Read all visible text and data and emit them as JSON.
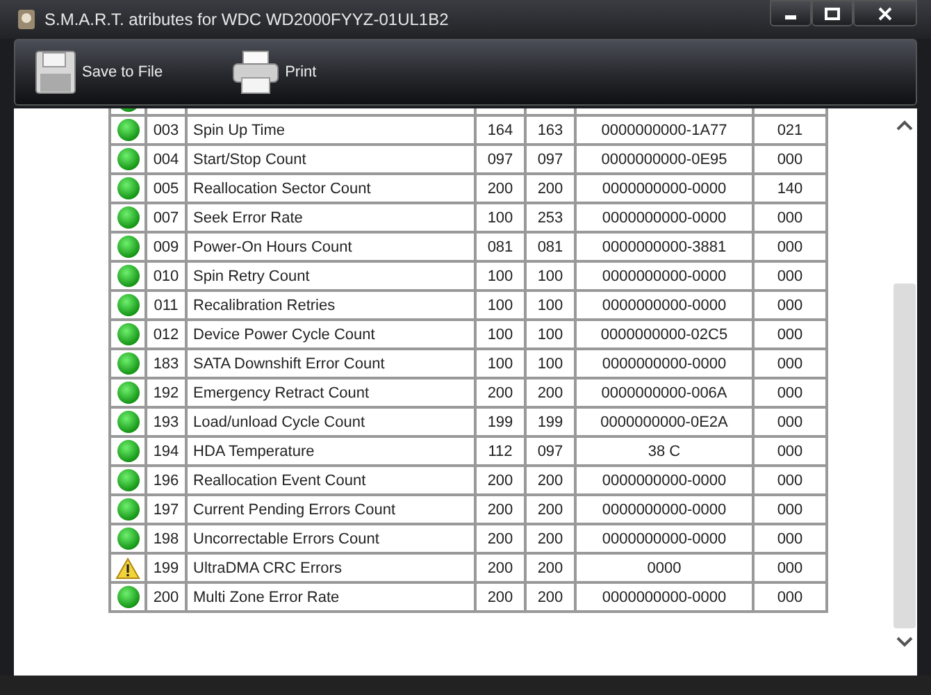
{
  "window": {
    "title": "S.M.A.R.T. atributes for WDC WD2000FYYZ-01UL1B2"
  },
  "toolbar": [
    {
      "kind": "save",
      "label": "Save to File"
    },
    {
      "kind": "print",
      "label": "Print"
    }
  ],
  "rows": [
    {
      "warning": false
    },
    {
      "warning": false,
      "id": "003",
      "name": "Spin Up Time",
      "value": "164",
      "worst": "163",
      "raw": "0000000000-1A77",
      "threshold": "021"
    },
    {
      "warning": false,
      "id": "004",
      "name": "Start/Stop Count",
      "value": "097",
      "worst": "097",
      "raw": "0000000000-0E95",
      "threshold": "000"
    },
    {
      "warning": false,
      "id": "005",
      "name": "Reallocation Sector Count",
      "value": "200",
      "worst": "200",
      "raw": "0000000000-0000",
      "threshold": "140"
    },
    {
      "warning": false,
      "id": "007",
      "name": "Seek Error Rate",
      "value": "100",
      "worst": "253",
      "raw": "0000000000-0000",
      "threshold": "000"
    },
    {
      "warning": false,
      "id": "009",
      "name": "Power-On Hours Count",
      "value": "081",
      "worst": "081",
      "raw": "0000000000-3881",
      "threshold": "000"
    },
    {
      "warning": false,
      "id": "010",
      "name": "Spin Retry Count",
      "value": "100",
      "worst": "100",
      "raw": "0000000000-0000",
      "threshold": "000"
    },
    {
      "warning": false,
      "id": "011",
      "name": "Recalibration Retries",
      "value": "100",
      "worst": "100",
      "raw": "0000000000-0000",
      "threshold": "000"
    },
    {
      "warning": false,
      "id": "012",
      "name": "Device Power Cycle Count",
      "value": "100",
      "worst": "100",
      "raw": "0000000000-02C5",
      "threshold": "000"
    },
    {
      "warning": false,
      "id": "183",
      "name": "SATA Downshift Error Count",
      "value": "100",
      "worst": "100",
      "raw": "0000000000-0000",
      "threshold": "000"
    },
    {
      "warning": false,
      "id": "192",
      "name": "Emergency Retract Count",
      "value": "200",
      "worst": "200",
      "raw": "0000000000-006A",
      "threshold": "000"
    },
    {
      "warning": false,
      "id": "193",
      "name": "Load/unload Cycle Count",
      "value": "199",
      "worst": "199",
      "raw": "0000000000-0E2A",
      "threshold": "000"
    },
    {
      "warning": false,
      "id": "194",
      "name": "HDA Temperature",
      "value": "112",
      "worst": "097",
      "raw": "38 C",
      "threshold": "000"
    },
    {
      "warning": false,
      "id": "196",
      "name": "Reallocation Event Count",
      "value": "200",
      "worst": "200",
      "raw": "0000000000-0000",
      "threshold": "000"
    },
    {
      "warning": false,
      "id": "197",
      "name": "Current Pending Errors Count",
      "value": "200",
      "worst": "200",
      "raw": "0000000000-0000",
      "threshold": "000"
    },
    {
      "warning": false,
      "id": "198",
      "name": "Uncorrectable Errors Count",
      "value": "200",
      "worst": "200",
      "raw": "0000000000-0000",
      "threshold": "000"
    },
    {
      "warning": true,
      "id": "199",
      "name": "UltraDMA CRC Errors",
      "value": "200",
      "worst": "200",
      "raw": "0000",
      "threshold": "000"
    },
    {
      "warning": false,
      "id": "200",
      "name": "Multi Zone Error Rate",
      "value": "200",
      "worst": "200",
      "raw": "0000000000-0000",
      "threshold": "000"
    }
  ]
}
